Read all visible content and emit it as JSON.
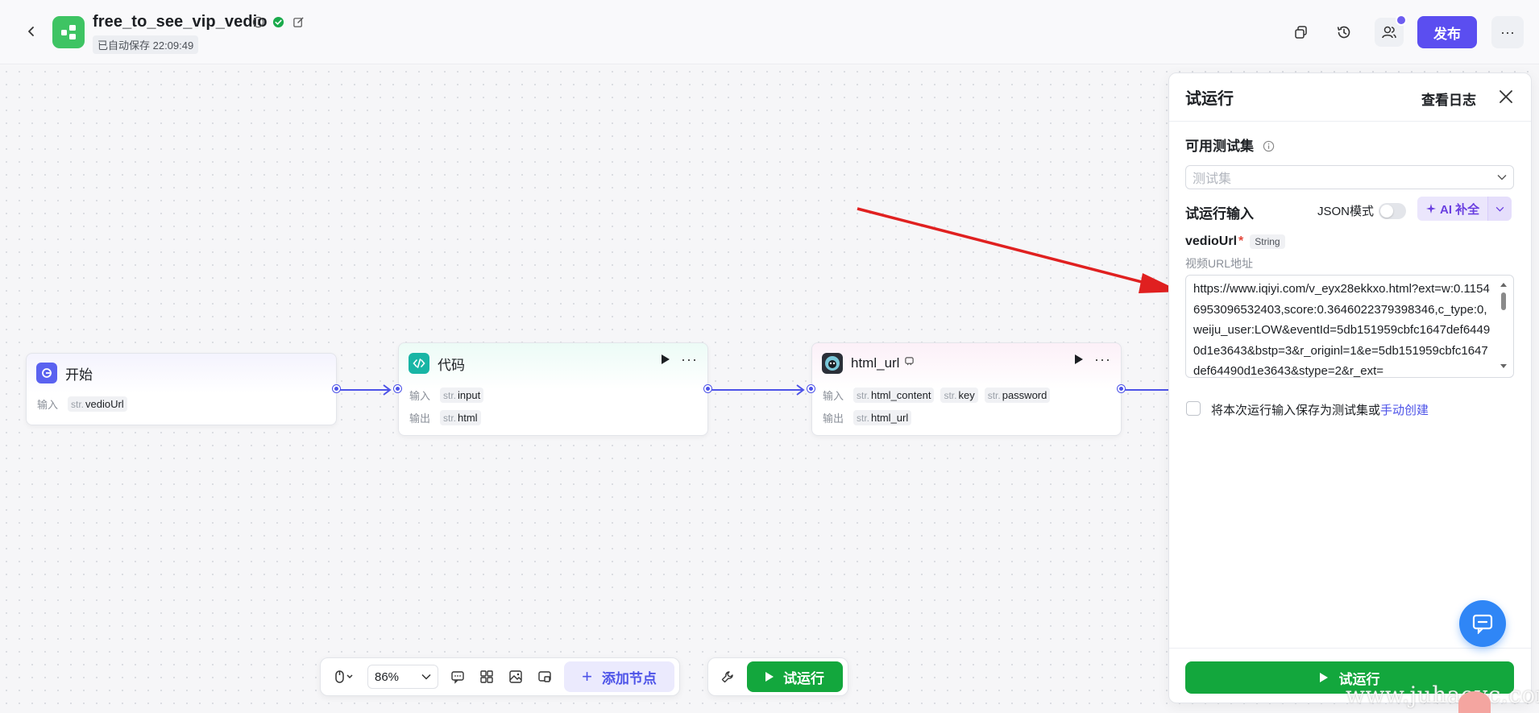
{
  "header": {
    "title": "free_to_see_vip_vedio",
    "autosave": "已自动保存 22:09:49",
    "publish_label": "发布",
    "more_label": "···"
  },
  "nodes": {
    "start": {
      "title": "开始",
      "input_label": "输入",
      "inputs": [
        {
          "type": "str.",
          "name": "vedioUrl"
        }
      ]
    },
    "code": {
      "title": "代码",
      "input_label": "输入",
      "output_label": "输出",
      "inputs": [
        {
          "type": "str.",
          "name": "input"
        }
      ],
      "outputs": [
        {
          "type": "str.",
          "name": "html"
        }
      ]
    },
    "html_url": {
      "title": "html_url",
      "input_label": "输入",
      "output_label": "输出",
      "inputs": [
        {
          "type": "str.",
          "name": "html_content"
        },
        {
          "type": "str.",
          "name": "key"
        },
        {
          "type": "str.",
          "name": "password"
        }
      ],
      "outputs": [
        {
          "type": "str.",
          "name": "html_url"
        }
      ]
    }
  },
  "toolbar": {
    "zoom": "86%",
    "add_node_label": "添加节点",
    "test_run_label": "试运行"
  },
  "panel": {
    "title": "试运行",
    "view_logs": "查看日志",
    "testset_label": "可用测试集",
    "testset_placeholder": "测试集",
    "run_input_label": "试运行输入",
    "json_mode_label": "JSON模式",
    "ai_complete_label": "AI 补全",
    "field_name": "vedioUrl",
    "field_required": "*",
    "field_type": "String",
    "field_desc": "视频URL地址",
    "field_value": "https://www.iqiyi.com/v_eyx28ekkxo.html?ext=w:0.11546953096532403,score:0.3646022379398346,c_type:0,weiju_user:LOW&eventId=5db151959cbfc1647def64490d1e3643&bstp=3&r_originl=1&e=5db151959cbfc1647def64490d1e3643&stype=2&r_ext=",
    "save_text": "将本次运行输入保存为测试集或",
    "manual_link": "手动创建",
    "run_button": "试运行"
  },
  "watermark": "www.juhaoyc.com",
  "colors": {
    "accent": "#4d53e8",
    "publish": "#5b4ef0",
    "run_green": "#13a73d",
    "arrow": "#e02020"
  }
}
